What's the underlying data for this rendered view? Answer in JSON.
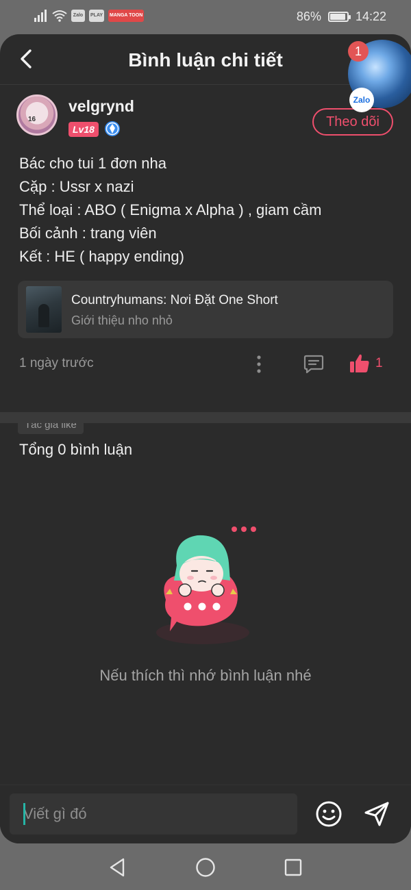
{
  "status_bar": {
    "apps": [
      "Zalo",
      "PLAY",
      "MANGA TOON"
    ],
    "battery": "86%",
    "battery_level": 0.86,
    "time": "14:22"
  },
  "header": {
    "title": "Bình luận chi tiết"
  },
  "author": {
    "name": "velgrynd",
    "avatar_badge": "16",
    "level": "Lv18",
    "follow_label": "Theo dõi"
  },
  "post": {
    "lines": [
      "Bác cho tui 1 đơn nha",
      "Cặp : Ussr x nazi",
      "Thể loại : ABO ( Enigma x Alpha ) , giam cầm",
      "Bối cảnh : trang viên",
      "Kết : HE ( happy ending)"
    ]
  },
  "book": {
    "title": "Countryhumans: Nơi Đặt One Short",
    "subtitle": "Giới thiệu nho nhỏ"
  },
  "meta": {
    "time": "1 ngày trước",
    "like_count": "1",
    "author_like_tag": "Tác giả like"
  },
  "comments": {
    "title": "Tổng 0 bình luận",
    "empty_text": "Nếu thích thì nhớ bình luận nhé"
  },
  "input": {
    "placeholder": "Viết gì đó"
  },
  "floating_bubble": {
    "badge": "1",
    "app": "Zalo"
  },
  "colors": {
    "accent": "#ef4f6d",
    "background": "#2b2b2b",
    "card": "#383838",
    "verify": "#3a8ef0",
    "teal_caret": "#26b5a6"
  },
  "icons": {
    "back": "back-arrow-icon",
    "verify": "verified-diamond-icon",
    "more": "more-vertical-icon",
    "comment": "comment-icon",
    "like": "thumbs-up-icon",
    "emoji": "emoji-icon",
    "send": "send-icon"
  }
}
